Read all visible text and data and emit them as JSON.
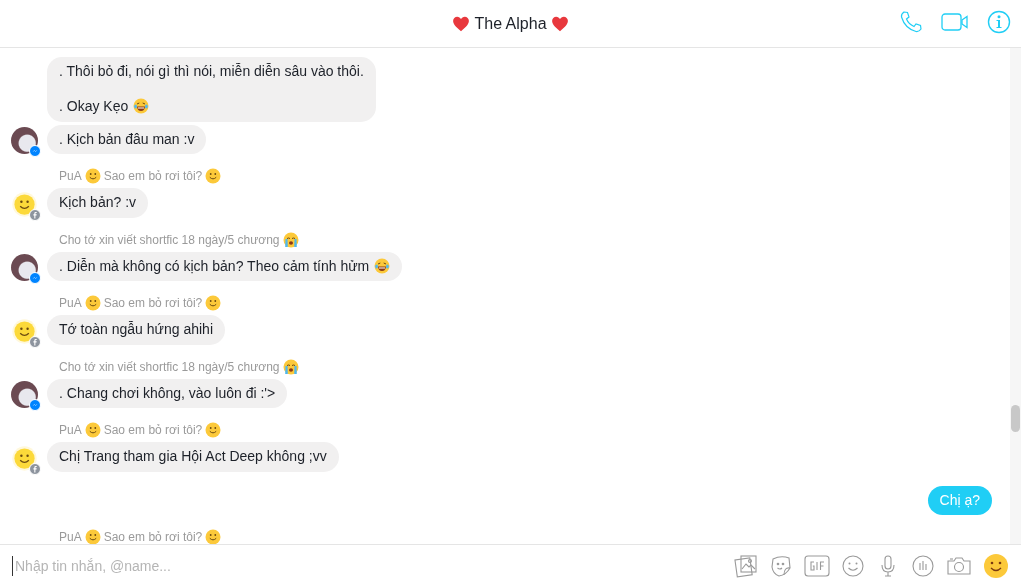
{
  "header": {
    "title": [
      {
        "kind": "heart"
      },
      {
        "kind": "text",
        "text": "The Alpha"
      },
      {
        "kind": "heart"
      }
    ]
  },
  "messages": [
    {
      "avatar": {
        "kind": "photo"
      },
      "badge": {
        "kind": "messenger"
      },
      "outgoing": false,
      "bubbles": [
        [
          {
            "kind": "text",
            "text": ". Thôi bỏ đi, nói gì thì nói, miễn diễn sâu vào thôi.\n\n. Okay Kẹo "
          },
          {
            "kind": "laugh"
          }
        ],
        [
          {
            "kind": "text",
            "text": ". Kịch bản đâu man :v"
          }
        ]
      ]
    },
    {
      "sender": [
        {
          "kind": "text",
          "text": "PuA"
        },
        {
          "kind": "smile"
        },
        {
          "kind": "text",
          "text": "Sao em bỏ rơi tôi?"
        },
        {
          "kind": "smile"
        }
      ],
      "avatar": {
        "kind": "smiley"
      },
      "badge": {
        "kind": "facebook"
      },
      "outgoing": false,
      "bubbles": [
        [
          {
            "kind": "text",
            "text": "Kịch bản? :v"
          }
        ]
      ]
    },
    {
      "sender": [
        {
          "kind": "text",
          "text": "Cho tớ xin viết shortfic 18 ngày/5 chương"
        },
        {
          "kind": "cry"
        }
      ],
      "avatar": {
        "kind": "photo"
      },
      "badge": {
        "kind": "messenger"
      },
      "outgoing": false,
      "bubbles": [
        [
          {
            "kind": "text",
            "text": ". Diễn mà không có kịch bản? Theo cảm tính hửm "
          },
          {
            "kind": "laugh"
          }
        ]
      ]
    },
    {
      "sender": [
        {
          "kind": "text",
          "text": "PuA"
        },
        {
          "kind": "smile"
        },
        {
          "kind": "text",
          "text": "Sao em bỏ rơi tôi?"
        },
        {
          "kind": "smile"
        }
      ],
      "avatar": {
        "kind": "smiley"
      },
      "badge": {
        "kind": "facebook"
      },
      "outgoing": false,
      "bubbles": [
        [
          {
            "kind": "text",
            "text": "Tớ toàn ngẫu hứng ahihi"
          }
        ]
      ]
    },
    {
      "sender": [
        {
          "kind": "text",
          "text": "Cho tớ xin viết shortfic 18 ngày/5 chương"
        },
        {
          "kind": "cry"
        }
      ],
      "avatar": {
        "kind": "photo"
      },
      "badge": {
        "kind": "messenger"
      },
      "outgoing": false,
      "bubbles": [
        [
          {
            "kind": "text",
            "text": ". Chang chơi không, vào luôn đi :'>"
          }
        ]
      ]
    },
    {
      "sender": [
        {
          "kind": "text",
          "text": "PuA"
        },
        {
          "kind": "smile"
        },
        {
          "kind": "text",
          "text": "Sao em bỏ rơi tôi?"
        },
        {
          "kind": "smile"
        }
      ],
      "avatar": {
        "kind": "smiley"
      },
      "badge": {
        "kind": "facebook"
      },
      "outgoing": false,
      "bubbles": [
        [
          {
            "kind": "text",
            "text": "Chị Trang tham gia Hội Act Deep không ;vv"
          }
        ]
      ]
    },
    {
      "outgoing": true,
      "bubbles": [
        [
          {
            "kind": "text",
            "text": "Chị ạ?"
          }
        ]
      ]
    },
    {
      "sender": [
        {
          "kind": "text",
          "text": "PuA"
        },
        {
          "kind": "smile"
        },
        {
          "kind": "text",
          "text": "Sao em bỏ rơi tôi?"
        },
        {
          "kind": "smile"
        }
      ]
    }
  ],
  "composer": {
    "placeholder": "Nhập tin nhắn, @name..."
  }
}
